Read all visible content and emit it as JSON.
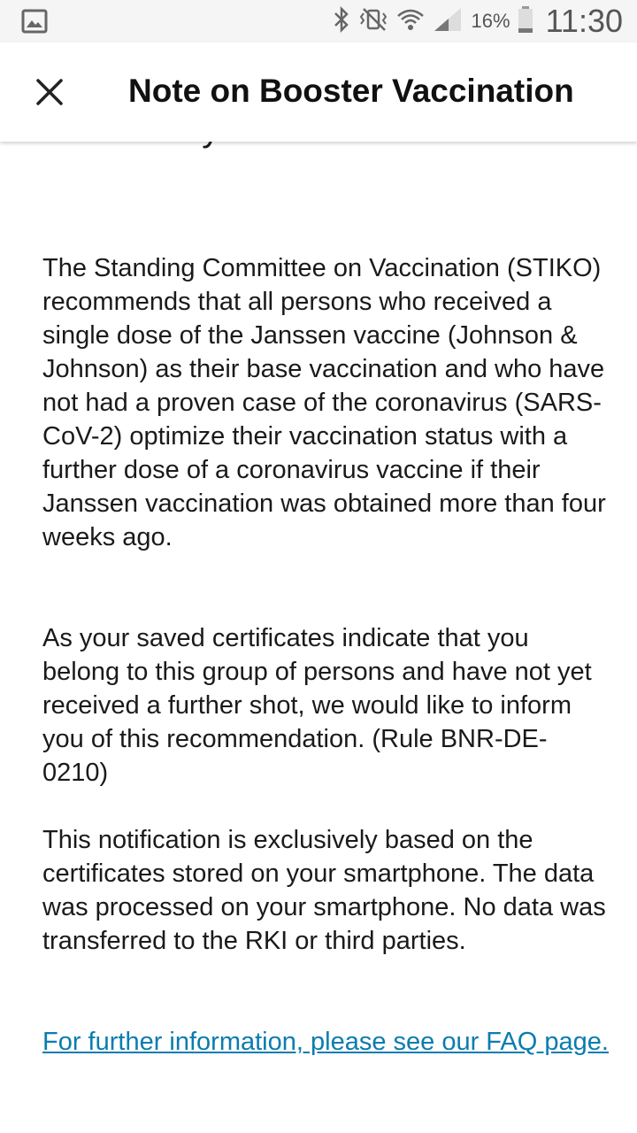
{
  "status_bar": {
    "battery": "16%",
    "time": "11:30",
    "icons": [
      "gallery-notification-icon",
      "bluetooth-icon",
      "vibrate-icon",
      "wifi-icon",
      "cell-signal-icon",
      "battery-icon"
    ]
  },
  "app_bar": {
    "title": "Note on Booster Vaccination",
    "close_icon": "close-icon"
  },
  "content": {
    "heading_partial": "based on your saved certificates",
    "paragraph_1": "The Standing Committee on Vaccination (STIKO) recommends that all persons who received a single dose of the Janssen vaccine (Johnson & Johnson) as their base vaccination and who have not had a proven case of the coronavirus (SARS-CoV-2) optimize their vaccination status with a further dose of a coronavirus vaccine if their Janssen vaccination was obtained more than four weeks ago.",
    "paragraph_2": "As your saved certificates indicate that you belong to this group of persons and have not yet received a further shot, we would like to inform you of this recommendation. (Rule BNR-DE-0210)",
    "paragraph_3": "This notification is exclusively based on the certificates stored on your smartphone. The data was processed on your smartphone. No data was transferred to the RKI or third parties.",
    "faq_link": "For further information, please see our FAQ page."
  },
  "colors": {
    "link": "#0a7cb0",
    "status_bar_bg": "#f5f5f5",
    "text": "#1a1a1a"
  }
}
